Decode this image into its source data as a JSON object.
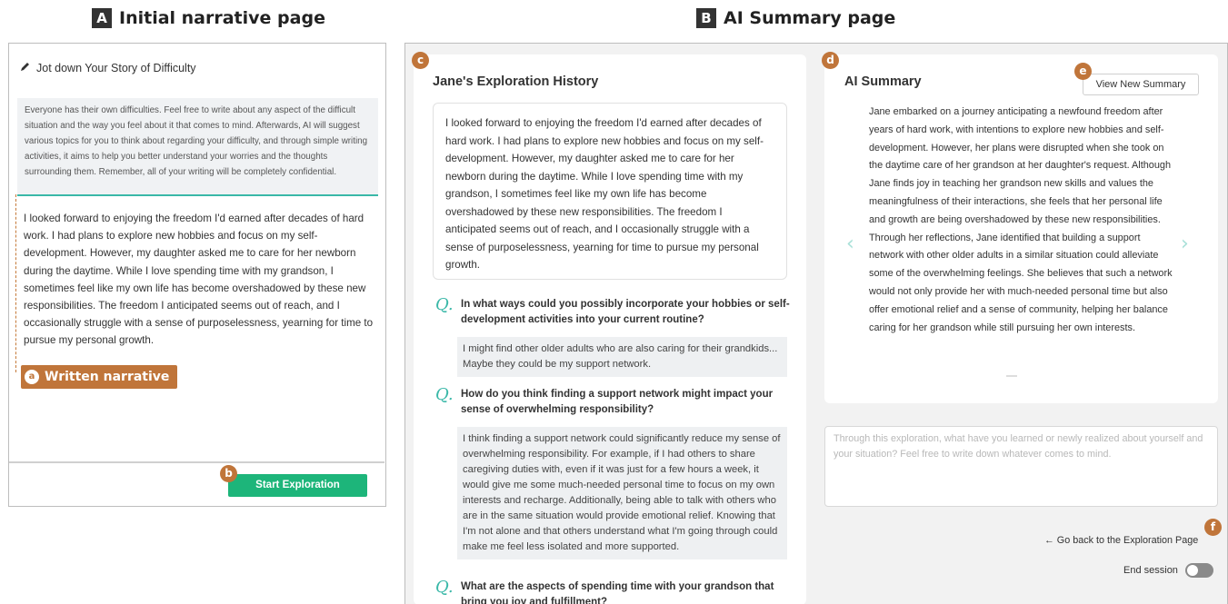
{
  "panel_a": {
    "letter": "A",
    "title": "Initial narrative page",
    "header": "Jot down Your Story of Difficulty",
    "info": "Everyone has their own difficulties. Feel free to write about any aspect of the difficult situation and the way you feel about it that comes to mind. Afterwards, AI will suggest various topics for you to think about regarding your difficulty, and through simple writing activities, it aims to help you better understand your worries and the thoughts surrounding them. Remember, all of your writing will be completely confidential.",
    "narrative": "I looked forward to enjoying the freedom I'd earned after decades of hard work. I had plans to explore new hobbies and focus on my self-development. However, my daughter asked me to care for her newborn during the daytime. While I love spending time with my grandson, I sometimes feel like my own life has become overshadowed by these new responsibilities. The freedom I anticipated seems out of reach, and I occasionally struggle with a sense of purposelessness, yearning for time to pursue my personal growth.",
    "tag_a": "a",
    "tag_label": "Written narrative",
    "tag_b": "b",
    "start_button": "Start Exploration"
  },
  "panel_b": {
    "letter": "B",
    "title": "AI Summary page",
    "tag_c": "c",
    "tag_d": "d",
    "tag_e": "e",
    "tag_f": "f",
    "history_title": "Jane's Exploration History",
    "story": "I looked forward to enjoying the freedom I'd earned after decades of hard work. I had plans to explore new hobbies and focus on my self-development. However, my daughter asked me to care for her newborn during the daytime. While I love spending time with my grandson, I sometimes feel like my own life has become overshadowed by these new responsibilities. The freedom I anticipated seems out of reach, and I occasionally struggle with a sense of purposelessness, yearning for time to pursue my personal growth.",
    "q_mark": "Q.",
    "qa": [
      {
        "q": "In what ways could you possibly incorporate your hobbies or self-development activities into your current routine?",
        "a": "I might find other older adults who are also caring for their grandkids... Maybe they could be my support network."
      },
      {
        "q": "How do you think finding a support network might impact your sense of overwhelming responsibility?",
        "a": "I think finding a support network could significantly reduce my sense of overwhelming responsibility. For example, if I had others to share caregiving duties with, even if it was just for a few hours a week, it would give me some much-needed personal time to focus on my own interests and recharge. Additionally, being able to talk with others who are in the same situation would provide emotional relief. Knowing that I'm not alone and that others understand what I'm going through could make me feel less isolated and more supported."
      },
      {
        "q": "What are the aspects of spending time with your grandson that bring you joy and fulfillment?",
        "a": ""
      }
    ],
    "summary_title": "AI Summary",
    "view_button": "View New Summary",
    "summary": "Jane embarked on a journey anticipating a newfound freedom after years of hard work, with intentions to explore new hobbies and self-development. However, her plans were disrupted when she took on the daytime care of her grandson at her daughter's request. Although Jane finds joy in teaching her grandson new skills and values the meaningfulness of their interactions, she feels that her personal life and growth are being overshadowed by these new responsibilities. Through her reflections, Jane identified that building a support network with other older adults in a similar situation could alleviate some of the overwhelming feelings. She believes that such a network would not only provide her with much-needed personal time but also offer emotional relief and a sense of community, helping her balance caring for her grandson while still pursuing her own interests.",
    "reflect_placeholder": "Through this exploration, what have you learned or newly realized about yourself and your situation? Feel free to write down whatever comes to mind.",
    "go_back": "← Go back to the Exploration Page",
    "end_session": "End session"
  }
}
